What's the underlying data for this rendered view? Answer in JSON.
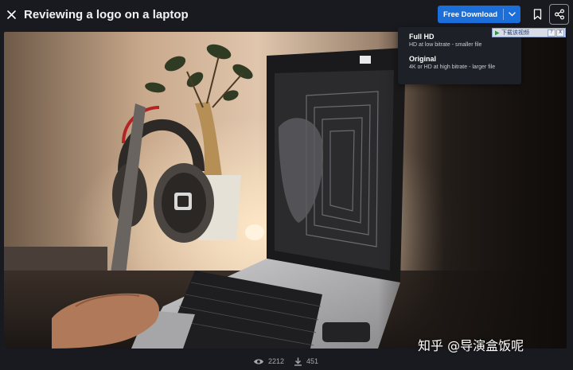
{
  "header": {
    "title": "Reviewing a logo on a laptop",
    "download_label": "Free Download"
  },
  "dropdown": {
    "options": [
      {
        "name": "Full HD",
        "desc": "HD at low bitrate - smaller file"
      },
      {
        "name": "Original",
        "desc": "4K or HD at high bitrate - larger file"
      }
    ]
  },
  "helper": {
    "text": "下载该视频",
    "help_label": "?",
    "close_label": "X"
  },
  "watermark": "知乎 @导演盒饭呢",
  "stats": {
    "views": "2212",
    "downloads": "451"
  },
  "colors": {
    "accent": "#1c6ed9",
    "background": "#181a20",
    "dropdown_bg": "#1d2027"
  },
  "icons": {
    "close": "close-icon",
    "caret": "chevron-down-icon",
    "bookmark": "bookmark-icon",
    "share": "share-icon",
    "views": "eye-icon",
    "downloads": "download-icon"
  }
}
